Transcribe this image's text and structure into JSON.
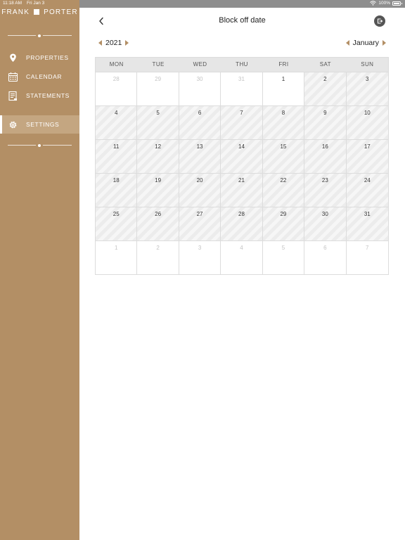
{
  "status_bar": {
    "time": "11:18 AM",
    "date": "Fri Jan 3",
    "battery": "100%"
  },
  "brand": {
    "left": "FRANK",
    "right": "PORTER"
  },
  "nav": {
    "properties": "PROPERTIES",
    "calendar": "CALENDAR",
    "statements": "STATEMENTS",
    "settings": "SETTINGS"
  },
  "header": {
    "title": "Block off date"
  },
  "selector": {
    "year": "2021",
    "month": "January"
  },
  "calendar": {
    "weekdays": [
      "MON",
      "TUE",
      "WED",
      "THU",
      "FRI",
      "SAT",
      "SUN"
    ],
    "days": [
      {
        "label": "28",
        "state": "muted"
      },
      {
        "label": "29",
        "state": "muted"
      },
      {
        "label": "30",
        "state": "muted"
      },
      {
        "label": "31",
        "state": "muted"
      },
      {
        "label": "1",
        "state": "open"
      },
      {
        "label": "2",
        "state": "blocked"
      },
      {
        "label": "3",
        "state": "blocked"
      },
      {
        "label": "4",
        "state": "blocked"
      },
      {
        "label": "5",
        "state": "blocked"
      },
      {
        "label": "6",
        "state": "blocked"
      },
      {
        "label": "7",
        "state": "blocked"
      },
      {
        "label": "8",
        "state": "blocked"
      },
      {
        "label": "9",
        "state": "blocked"
      },
      {
        "label": "10",
        "state": "blocked"
      },
      {
        "label": "11",
        "state": "blocked"
      },
      {
        "label": "12",
        "state": "blocked"
      },
      {
        "label": "13",
        "state": "blocked"
      },
      {
        "label": "14",
        "state": "blocked"
      },
      {
        "label": "15",
        "state": "blocked"
      },
      {
        "label": "16",
        "state": "blocked"
      },
      {
        "label": "17",
        "state": "blocked"
      },
      {
        "label": "18",
        "state": "blocked"
      },
      {
        "label": "19",
        "state": "blocked"
      },
      {
        "label": "20",
        "state": "blocked"
      },
      {
        "label": "21",
        "state": "blocked"
      },
      {
        "label": "22",
        "state": "blocked"
      },
      {
        "label": "23",
        "state": "blocked"
      },
      {
        "label": "24",
        "state": "blocked"
      },
      {
        "label": "25",
        "state": "blocked"
      },
      {
        "label": "26",
        "state": "blocked"
      },
      {
        "label": "27",
        "state": "blocked"
      },
      {
        "label": "28",
        "state": "blocked"
      },
      {
        "label": "29",
        "state": "blocked"
      },
      {
        "label": "30",
        "state": "blocked"
      },
      {
        "label": "31",
        "state": "blocked"
      },
      {
        "label": "1",
        "state": "muted"
      },
      {
        "label": "2",
        "state": "muted"
      },
      {
        "label": "3",
        "state": "muted"
      },
      {
        "label": "4",
        "state": "muted"
      },
      {
        "label": "5",
        "state": "muted"
      },
      {
        "label": "6",
        "state": "muted"
      },
      {
        "label": "7",
        "state": "muted"
      }
    ]
  },
  "colors": {
    "sidebar": "#b38f65",
    "sidebar_active": "#c4a681",
    "accent_arrow": "#b38f65"
  },
  "icons": {
    "properties": "map-pin-icon",
    "calendar": "calendar-icon",
    "statements": "document-icon",
    "settings": "gear-icon",
    "back": "chevron-left-icon",
    "export": "export-icon"
  }
}
